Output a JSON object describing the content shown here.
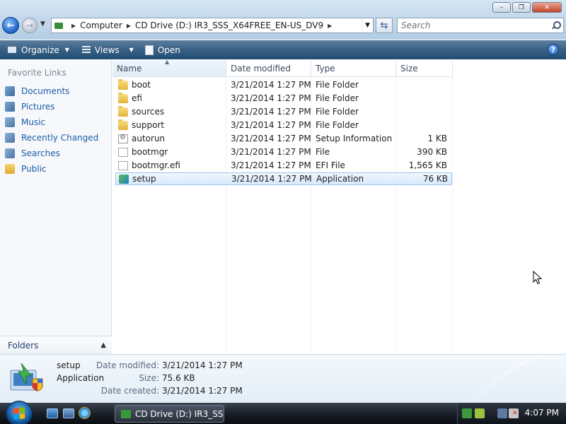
{
  "window": {
    "buttons": [
      "–",
      "❐",
      "✕"
    ]
  },
  "address": {
    "segments": [
      "Computer",
      "CD Drive (D:) IR3_SSS_X64FREE_EN-US_DV9"
    ],
    "search_placeholder": "Search"
  },
  "toolbar": {
    "organize": "Organize",
    "views": "Views",
    "open": "Open",
    "help": "?"
  },
  "nav": {
    "header": "Favorite Links",
    "items": [
      {
        "label": "Documents",
        "icon": "documents-icon"
      },
      {
        "label": "Pictures",
        "icon": "pictures-icon"
      },
      {
        "label": "Music",
        "icon": "music-icon"
      },
      {
        "label": "Recently Changed",
        "icon": "recently-changed-icon"
      },
      {
        "label": "Searches",
        "icon": "searches-icon"
      },
      {
        "label": "Public",
        "icon": "public-folder-icon"
      }
    ],
    "folders": "Folders"
  },
  "columns": {
    "name": "Name",
    "date": "Date modified",
    "type": "Type",
    "size": "Size"
  },
  "files": [
    {
      "name": "boot",
      "date": "3/21/2014 1:27 PM",
      "type": "File Folder",
      "size": "",
      "icon": "folder"
    },
    {
      "name": "efi",
      "date": "3/21/2014 1:27 PM",
      "type": "File Folder",
      "size": "",
      "icon": "folder"
    },
    {
      "name": "sources",
      "date": "3/21/2014 1:27 PM",
      "type": "File Folder",
      "size": "",
      "icon": "folder"
    },
    {
      "name": "support",
      "date": "3/21/2014 1:27 PM",
      "type": "File Folder",
      "size": "",
      "icon": "folder"
    },
    {
      "name": "autorun",
      "date": "3/21/2014 1:27 PM",
      "type": "Setup Information",
      "size": "1 KB",
      "icon": "setupinfo"
    },
    {
      "name": "bootmgr",
      "date": "3/21/2014 1:27 PM",
      "type": "File",
      "size": "390 KB",
      "icon": "file"
    },
    {
      "name": "bootmgr.efi",
      "date": "3/21/2014 1:27 PM",
      "type": "EFI File",
      "size": "1,565 KB",
      "icon": "file"
    },
    {
      "name": "setup",
      "date": "3/21/2014 1:27 PM",
      "type": "Application",
      "size": "76 KB",
      "icon": "app",
      "selected": true
    }
  ],
  "details": {
    "name": "setup",
    "type": "Application",
    "date_modified_label": "Date modified:",
    "date_modified": "3/21/2014 1:27 PM",
    "size_label": "Size:",
    "size": "75.6 KB",
    "date_created_label": "Date created:",
    "date_created": "3/21/2014 1:27 PM"
  },
  "taskbar": {
    "task_label": "CD Drive (D:) IR3_SS...",
    "clock": "4:07 PM"
  }
}
